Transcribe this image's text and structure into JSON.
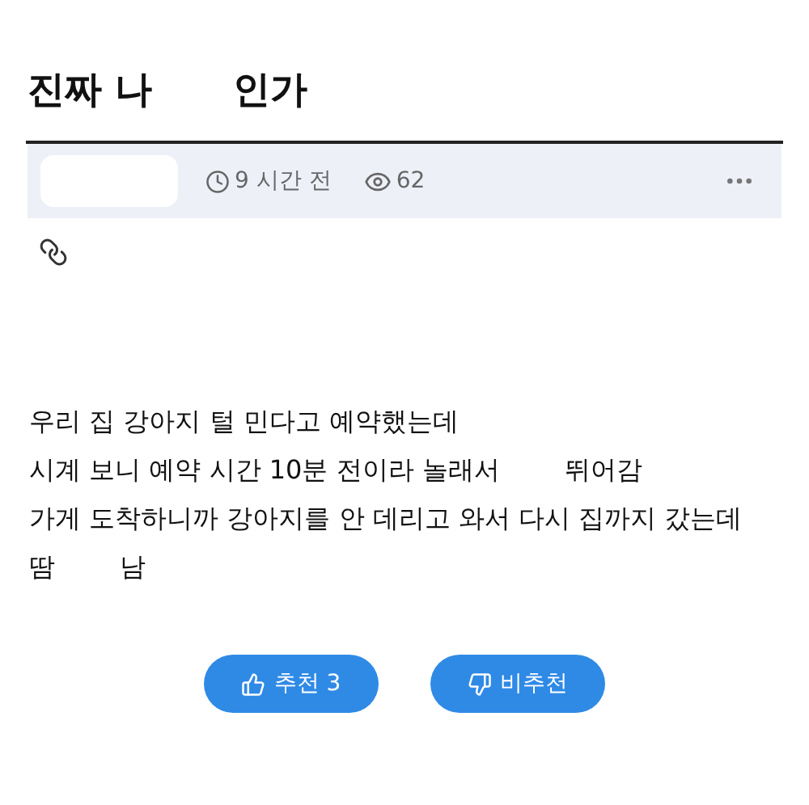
{
  "title": [
    "진짜 나",
    "인가"
  ],
  "meta": {
    "time": "9 시간 전",
    "views": "62"
  },
  "body": [
    [
      "우리 집 강아지 털 민다고 예약했는데"
    ],
    [
      "시계 보니 예약 시간 10분 전이라 놀래서",
      "뛰어감"
    ],
    [
      "가게 도착하니까 강아지를 안 데리고 와서 다시 집까지 갔는데"
    ],
    [
      "땀",
      "남"
    ]
  ],
  "buttons": [
    {
      "kind": "up",
      "label": "추천 3"
    },
    {
      "kind": "down",
      "label": "비추천"
    }
  ]
}
